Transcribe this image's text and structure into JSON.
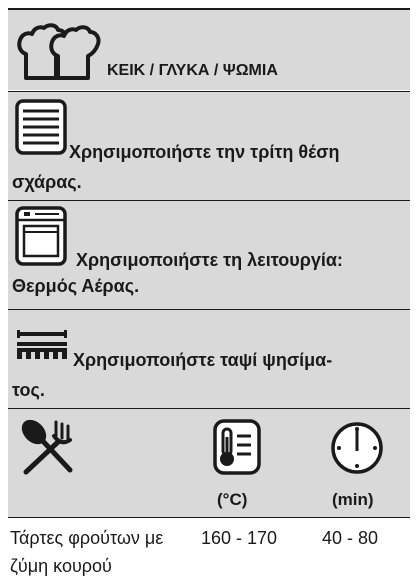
{
  "header": {
    "title": "ΚΕΙΚ / ΓΛΥΚΑ / ΨΩΜΙΑ",
    "icon": "bread-loaves-icon"
  },
  "instructions": [
    {
      "icon": "shelf-position-icon",
      "line1": "Χρησιμοποιήστε την τρίτη θέση",
      "line2": "σχάρας."
    },
    {
      "icon": "oven-function-icon",
      "line1": "Χρησιμοποιήστε τη λειτουργία:",
      "line2": "Θερμός Αέρας."
    },
    {
      "icon": "baking-tray-icon",
      "line1": "Χρησιμοποιήστε ταψί ψησίμα-",
      "line2": "τος."
    }
  ],
  "table": {
    "header_icons": [
      "cutlery-icon",
      "thermometer-icon",
      "timer-icon"
    ],
    "temp_unit": "(°C)",
    "time_unit": "(min)",
    "rows": [
      {
        "food_line1": "Τάρτες φρούτων με",
        "food_line2": "ζύμη κουρού",
        "temperature": "160 - 170",
        "time": "40 - 80"
      }
    ]
  },
  "colors": {
    "band": "#d9d9d9",
    "text": "#1a1a1a",
    "rule": "#1a1a1a"
  }
}
